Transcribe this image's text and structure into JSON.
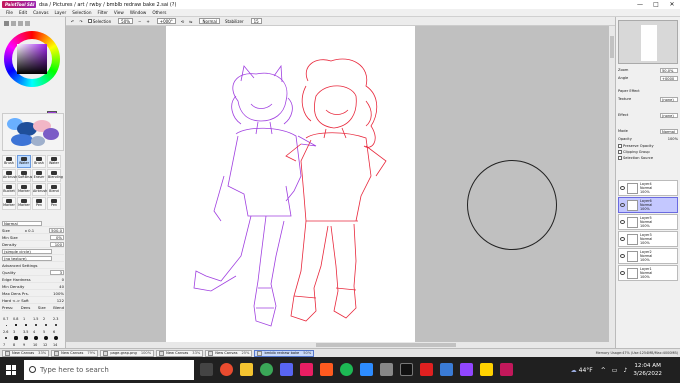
{
  "app": {
    "logo_text": "PaintTool SAI",
    "title": "dsa / Pictures / art / rwby / bmblb redraw bake 2.sai (?)"
  },
  "window": {
    "min": "—",
    "max": "□",
    "close": "✕"
  },
  "menu": [
    "File",
    "Edit",
    "Canvas",
    "Layer",
    "Selection",
    "Filter",
    "View",
    "Window",
    "Others"
  ],
  "toolbar": {
    "selection_label": "Selection",
    "zoom": "50%",
    "angle": "+000°",
    "mode": "Normal",
    "stabilizer_label": "Stabilizer",
    "stabilizer": "15"
  },
  "left_panel": {
    "tools": [
      "Brush",
      "Water",
      "Brush",
      "Water",
      "Airbrush",
      "SoftBrush",
      "Eraser",
      "Blending",
      "Bucket",
      "Marker",
      "Airbrush",
      "Blend",
      "Marker",
      "Marker",
      "Pen",
      "Pen"
    ],
    "mode": "Normal",
    "size_label": "Size",
    "size_mult": "x 0.1",
    "size": "500.0",
    "min_size_label": "Min Size",
    "min_size": "0%",
    "density_label": "Density",
    "density": "100",
    "shape": "(simple circle)",
    "texture": "(no texture)",
    "advanced": "Advanced Settings",
    "quality_label": "Quality",
    "quality": "3",
    "edge_label": "Edge Hardness",
    "edge": "0",
    "min_density_label": "Min Density",
    "min_density": "40",
    "max_dens_label": "Max Dens Prs.",
    "max_dens": "100%",
    "hard_soft_label": "Hard <-> Soft",
    "hard_soft": "122",
    "press_label": "Press:",
    "press_opts": [
      "Dens",
      "Size",
      "Blend"
    ],
    "dot_sizes": [
      "0.7",
      "0.8",
      "1",
      "1.5",
      "2",
      "2.3",
      "2.6",
      "3",
      "3.5",
      "4",
      "5",
      "6",
      "7",
      "8",
      "9",
      "10",
      "12",
      "14",
      "16",
      "20",
      "25",
      "30",
      "35",
      "40"
    ]
  },
  "right_panel": {
    "zoom_label": "Zoom",
    "zoom": "50.0%",
    "angle_label": "Angle",
    "angle": "+0000",
    "paper_effect": "Paper Effect",
    "texture_label": "Texture",
    "texture": "(none)",
    "effect_label": "Effect",
    "effect": "(none)",
    "mode_label": "Mode",
    "mode": "Normal",
    "opacity_label": "Opacity",
    "opacity": "100%",
    "opts": [
      "Preserve Opacity",
      "Clipping Group",
      "Selection Source"
    ],
    "layers": [
      {
        "name": "Layer4",
        "mode": "Normal",
        "op": "100%"
      },
      {
        "name": "Layer6",
        "mode": "Normal",
        "op": "100%"
      },
      {
        "name": "Layer5",
        "mode": "Normal",
        "op": "100%"
      },
      {
        "name": "Layer3",
        "mode": "Normal",
        "op": "100%"
      },
      {
        "name": "Layer2",
        "mode": "Normal",
        "op": "100%"
      },
      {
        "name": "Layer1",
        "mode": "Normal",
        "op": "100%"
      }
    ]
  },
  "doc_tabs": [
    {
      "name": "New Canvas",
      "zoom": "33%"
    },
    {
      "name": "New Canvas",
      "zoom": "79%"
    },
    {
      "name": "page-grap.png",
      "zoom": "100%"
    },
    {
      "name": "New Canvas",
      "zoom": "33%"
    },
    {
      "name": "New Canvas",
      "zoom": "25%"
    },
    {
      "name": "bmblb redraw bake",
      "zoom": "50%"
    }
  ],
  "memory": "Memory Usage:47% (Use:1254MB/Max:4000MB)",
  "taskbar": {
    "search": "Type here to search",
    "weather": "44°F",
    "time": "12:04 AM",
    "date": "3/26/2022"
  },
  "colors": {
    "purple": "#a040e0",
    "red": "#e8283c",
    "accent": "#5577cc"
  }
}
